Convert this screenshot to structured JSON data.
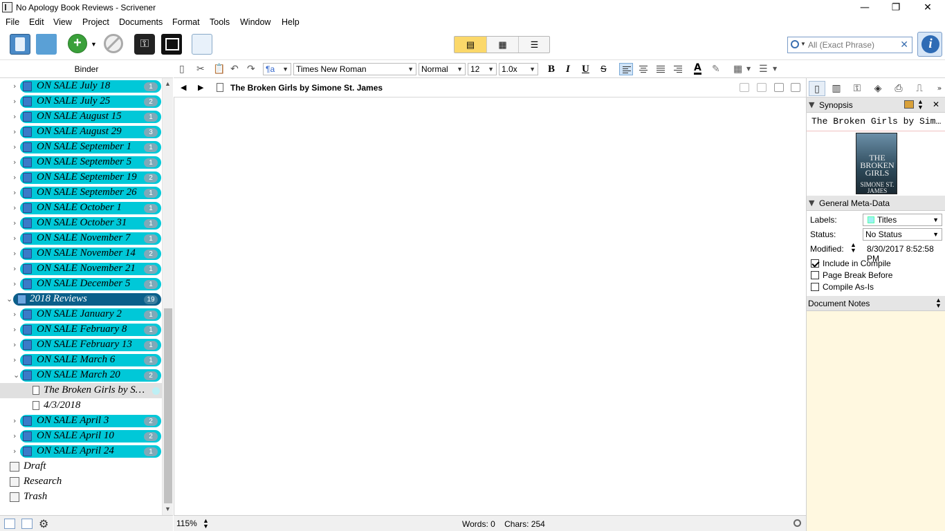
{
  "window": {
    "title": "No Apology Book Reviews - Scrivener",
    "minimize": "—",
    "restore": "❐",
    "close": "✕"
  },
  "menu": [
    "File",
    "Edit",
    "View",
    "Project",
    "Documents",
    "Format",
    "Tools",
    "Window",
    "Help"
  ],
  "search": {
    "placeholder": "All (Exact Phrase)",
    "clear": "✕"
  },
  "binder": {
    "header": "Binder",
    "items": [
      {
        "label": "ON SALE July 18",
        "count": "1"
      },
      {
        "label": "ON SALE July 25",
        "count": "2"
      },
      {
        "label": "ON SALE August 15",
        "count": "1"
      },
      {
        "label": "ON SALE August 29",
        "count": "3"
      },
      {
        "label": "ON SALE September 1",
        "count": "1"
      },
      {
        "label": "ON SALE September 5",
        "count": "1"
      },
      {
        "label": "ON SALE September 19",
        "count": "2"
      },
      {
        "label": "ON SALE September 26",
        "count": "1"
      },
      {
        "label": "ON SALE October 1",
        "count": "1"
      },
      {
        "label": "ON SALE October 31",
        "count": "1"
      },
      {
        "label": "ON SALE November 7",
        "count": "1"
      },
      {
        "label": "ON SALE November 14",
        "count": "2"
      },
      {
        "label": "ON SALE November 21",
        "count": "1"
      },
      {
        "label": "ON SALE December 5",
        "count": "1"
      }
    ],
    "group": {
      "label": "2018 Reviews",
      "count": "19"
    },
    "items2018": [
      {
        "label": "ON SALE January 2",
        "count": "1"
      },
      {
        "label": "ON SALE February 8",
        "count": "1"
      },
      {
        "label": "ON SALE February 13",
        "count": "1"
      },
      {
        "label": "ON SALE March 6",
        "count": "1"
      },
      {
        "label": "ON SALE March 20",
        "count": "2"
      }
    ],
    "docs": [
      "The Broken Girls by S…",
      "4/3/2018"
    ],
    "itemsAfter": [
      {
        "label": "ON SALE April 3",
        "count": "2"
      },
      {
        "label": "ON SALE April 10",
        "count": "2"
      },
      {
        "label": "ON SALE April 24",
        "count": "1"
      }
    ],
    "roots": [
      "Draft",
      "Research",
      "Trash"
    ]
  },
  "format": {
    "font": "Times New Roman",
    "style": "Normal",
    "size": "12",
    "spacing": "1.0x",
    "bold": "B",
    "italic": "I",
    "underline": "U",
    "strike": "S"
  },
  "editor": {
    "doc_title": "The Broken Girls by Simone St. James",
    "zoom": "115%",
    "counts": "Words: 0    Chars: 254"
  },
  "inspector": {
    "synopsis_title": "Synopsis",
    "synopsis_text": "The Broken Girls by Simone St. James",
    "cover_title": "THE BROKEN GIRLS",
    "cover_author": "SIMONE ST. JAMES",
    "meta_title": "General Meta-Data",
    "labels_label": "Labels:",
    "labels_value": "Titles",
    "status_label": "Status:",
    "status_value": "No Status",
    "modified_label": "Modified:",
    "modified_value": "8/30/2017 8:52:58 PM",
    "include_compile": "Include in Compile",
    "page_break": "Page Break Before",
    "compile_as_is": "Compile As-Is",
    "notes_title": "Document Notes"
  },
  "colors": {
    "pill": "#00c8d8",
    "group_pill": "#0a5f8a",
    "notes_bg": "#fff8e0"
  }
}
